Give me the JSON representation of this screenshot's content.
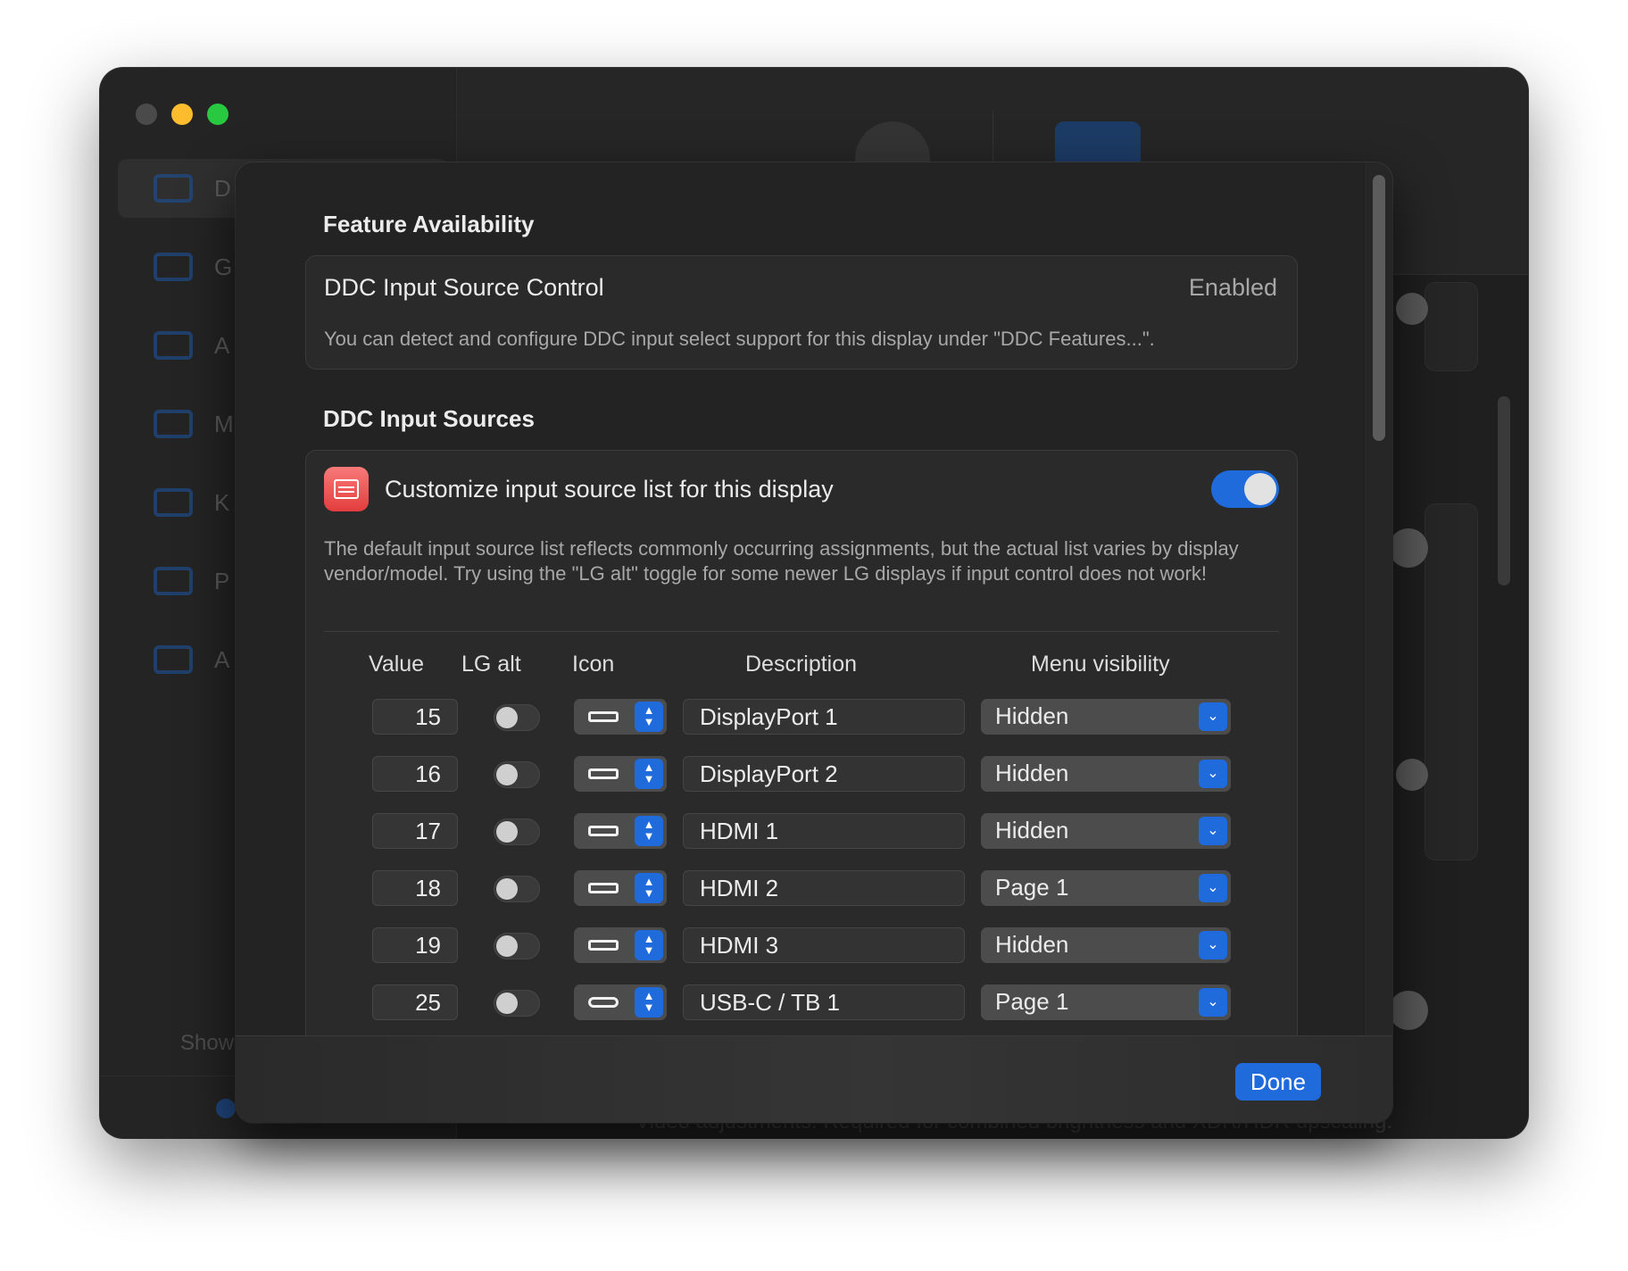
{
  "background_window": {
    "sidebar_items": [
      "D",
      "G",
      "A",
      "M",
      "K",
      "P",
      "A"
    ],
    "sidebar_footer": "Show",
    "bg_text": "Video adjustments. Required for combined brightness and XDR/HDR upscaling."
  },
  "feature_availability": {
    "title": "Feature Availability",
    "label": "DDC Input Source Control",
    "status": "Enabled",
    "description": "You can detect and configure DDC input select support for this display under \"DDC Features...\"."
  },
  "input_sources": {
    "title": "DDC Input Sources",
    "customize_label": "Customize input source list for this display",
    "customize_enabled": true,
    "description": "The default input source list reflects commonly occurring assignments, but the actual list varies by display vendor/model. Try using the \"LG alt\" toggle for some newer LG displays if input control does not work!",
    "columns": {
      "value": "Value",
      "lg_alt": "LG alt",
      "icon": "Icon",
      "description": "Description",
      "menu_visibility": "Menu visibility"
    },
    "rows": [
      {
        "value": "15",
        "lg_alt": false,
        "icon": "displayport-icon",
        "description": "DisplayPort 1",
        "visibility": "Hidden"
      },
      {
        "value": "16",
        "lg_alt": false,
        "icon": "displayport-icon",
        "description": "DisplayPort 2",
        "visibility": "Hidden"
      },
      {
        "value": "17",
        "lg_alt": false,
        "icon": "hdmi-icon",
        "description": "HDMI 1",
        "visibility": "Hidden"
      },
      {
        "value": "18",
        "lg_alt": false,
        "icon": "hdmi-icon",
        "description": "HDMI 2",
        "visibility": "Page 1"
      },
      {
        "value": "19",
        "lg_alt": false,
        "icon": "hdmi-icon",
        "description": "HDMI 3",
        "visibility": "Hidden"
      },
      {
        "value": "25",
        "lg_alt": false,
        "icon": "usbc-icon",
        "description": "USB-C / TB 1",
        "visibility": "Page 1"
      }
    ]
  },
  "footer": {
    "done_label": "Done"
  },
  "colors": {
    "accent": "#1f6bdc",
    "sheet_bg": "#232323",
    "box_bg": "#2a2a2a"
  }
}
